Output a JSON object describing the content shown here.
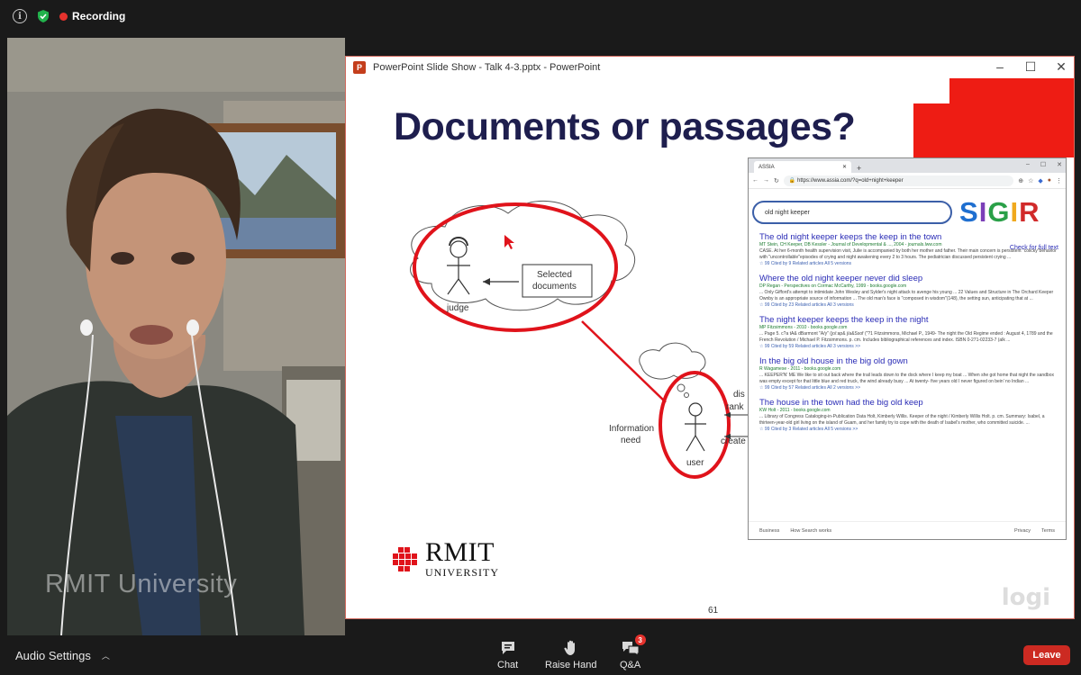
{
  "topbar": {
    "recording_label": "Recording",
    "icons": [
      "info-icon",
      "shield-check-icon",
      "record-dot-icon"
    ]
  },
  "video": {
    "watermark": "RMIT University"
  },
  "powerpoint": {
    "window_title": "PowerPoint Slide Show  -  Talk 4-3.pptx - PowerPoint",
    "controls": [
      "minimize",
      "maximize",
      "close"
    ]
  },
  "slide": {
    "title": "Documents or passages?",
    "diagram": {
      "judge_label": "judge",
      "selected_documents": [
        "Selected",
        "documents"
      ],
      "information_need": [
        "Information",
        "need"
      ],
      "user_label": "user",
      "partial_labels": [
        "dis",
        "rank",
        "create"
      ]
    },
    "logo": {
      "name": "RMIT",
      "sub": "UNIVERSITY"
    },
    "page_number": "61",
    "corner_watermark": "logi"
  },
  "browser": {
    "tab_title": "ASSIA",
    "url": "https://www.assia.com/?q=old+night+keeper",
    "search_query": "old night keeper",
    "brand": {
      "letters": [
        "S",
        "I",
        "G",
        "I",
        "R"
      ],
      "colors": [
        "#1f6fd0",
        "#7b3fb8",
        "#2aa048",
        "#f0a91e",
        "#d12a2a"
      ]
    },
    "full_text_link": "Check for full text",
    "results": [
      {
        "title": "The old night keeper keeps the keep in the town",
        "meta": "MT Stein, CH Keeper, DB Kessler - Journal of Developmental & ..., 2004 - journals.lww.com",
        "snippet": "CASE. At her 6-month health supervision visit, Julie is accompanied by both her mother and father. Their main concern is persistent \"colicky\"behavior with \"uncontrollable\"episodes of crying and night awakening every 2 to 3 hours. The pediatrician discussed persistent crying ...",
        "links": "☆  99   Cited by 9   Related articles   All 5 versions"
      },
      {
        "title": "Where the old night keeper never did sleep",
        "meta": "DP Regan - Perspectives on Cormac McCarthy, 1999 - books.google.com",
        "snippet": "... Only Gifford's attempt to intimidate John Wesley and Sylder's night attack to avenge his young ... 22 Values and Structure in The Orchard Keeper Ownby is an appropriate source of information ... The old man's face is \"composed in wisdom\"(148), the setting sun, anticipating that at ...",
        "links": "☆  99   Cited by 23   Related articles   All 3 versions"
      },
      {
        "title": "The night keeper keeps the keep in the night",
        "meta": "MP Fitzsimmons - 2010 - books.google.com",
        "snippet": "... Page 5. c?a tA& dBarmont \"A/y\" (jo/:ap& j/a&Ssof (\"?1 Fitzsimmons, Michael P., 1949- The night the Old Regime ended : August 4, 1789 and the French Revolution / Michael P. Fitzsimmons. p. cm. Includes bibliographical references and index. ISBN 0-271-02233-7 (alk ...",
        "links": "☆  99   Cited by 59   Related articles   All 3 versions   >>"
      },
      {
        "title": "In the big old house in the big old gown",
        "meta": "R Wagamese - 2011 - books.google.com",
        "snippet": "... KEEPER'N' ME We like to sit out back where the trail leads down to the dock where I keep my boat ... When she got home that night the sandbox was empty except for that little blue and red truck, the wind already busy ... At twenty- five years old I never figured on bein' no Indian ...",
        "links": "☆  99   Cited by 57   Related articles   All 2 versions   >>"
      },
      {
        "title": "The house in the town had the big old keep",
        "meta": "KW Holt - 2011 - books.google.com",
        "snippet": "... Library of Congress Cataloging-in-Publication Data Holt, Kimberly Willis. Keeper of the night / Kimberly Willis Holt. p. cm. Summary: Isabel, a thirteen-year-old girl living on the island of Guam, and her family try to cope with the death of Isabel's mother, who committed suicide. ...",
        "links": "☆  99   Cited by 3   Related articles   All 5 versions   >>"
      }
    ],
    "footer": {
      "left": [
        "Business",
        "How Search works"
      ],
      "right": [
        "Privacy",
        "Terms"
      ]
    }
  },
  "bottombar": {
    "audio_settings": "Audio Settings",
    "chat": "Chat",
    "raise_hand": "Raise Hand",
    "qa": "Q&A",
    "qa_badge": "3",
    "leave": "Leave",
    "leave_color": "#cc2a22"
  }
}
